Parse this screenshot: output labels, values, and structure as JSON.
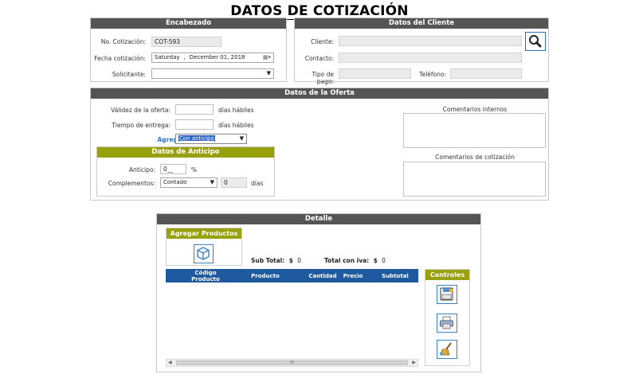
{
  "page_title": "DATOS DE COTIZACIÓN",
  "encabezado": {
    "title": "Encabezado",
    "no_cotizacion_label": "No. Cotización:",
    "no_cotizacion_value": "COT-593",
    "fecha_label": "Fecha cotización:",
    "fecha_weekday": "Saturday",
    "fecha_date": "December 01, 2018",
    "solicitante_label": "Solicitante:"
  },
  "cliente": {
    "title": "Datos del Cliente",
    "cliente_label": "Cliente:",
    "contacto_label": "Contacto:",
    "tipo_pago_label": "Tipo de pago:",
    "telefono_label": "Teléfono:",
    "search_icon": "search-icon"
  },
  "oferta": {
    "title": "Datos de la Oferta",
    "validez_label": "Válidez de la oferta:",
    "validez_units": "días hábiles",
    "tiempo_label": "Tiempo de entrega:",
    "tiempo_units": "días hábiles",
    "anticipo_q_label": "Agregar Anticipo:",
    "anticipo_q_value": "Con anticipo",
    "comentarios_internos_label": "Comentarios internos",
    "comentarios_cotizacion_label": "Comentarios de cotización"
  },
  "anticipo": {
    "title": "Datos de Anticipo",
    "anticipo_label": "Anticipo:",
    "anticipo_value": "0__",
    "percent": "%",
    "complementos_label": "Complementos:",
    "complementos_value": "Contado",
    "dias_value": "0",
    "dias_label": "días"
  },
  "detalle": {
    "title": "Detalle",
    "agregar_productos": "Agregar Productos",
    "subtotal_label": "Sub Total:",
    "subtotal_currency": "$",
    "subtotal_value": "0",
    "total_iva_label": "Total con iva:",
    "total_iva_currency": "$",
    "total_iva_value": "0",
    "columns": {
      "codigo_line1": "Código",
      "codigo_line2": "Producto",
      "producto": "Producto",
      "cantidad": "Cantidad",
      "precio": "Precio",
      "subtotal": "Subtotal"
    },
    "scroll_grip": "III"
  },
  "controles": {
    "title": "Controles",
    "buttons": [
      "save-icon",
      "print-icon",
      "clear-icon"
    ]
  },
  "colors": {
    "panel_header": "#555555",
    "olive": "#99a00e",
    "table_header": "#1f5aa0",
    "link_blue": "#2a7ad4"
  }
}
